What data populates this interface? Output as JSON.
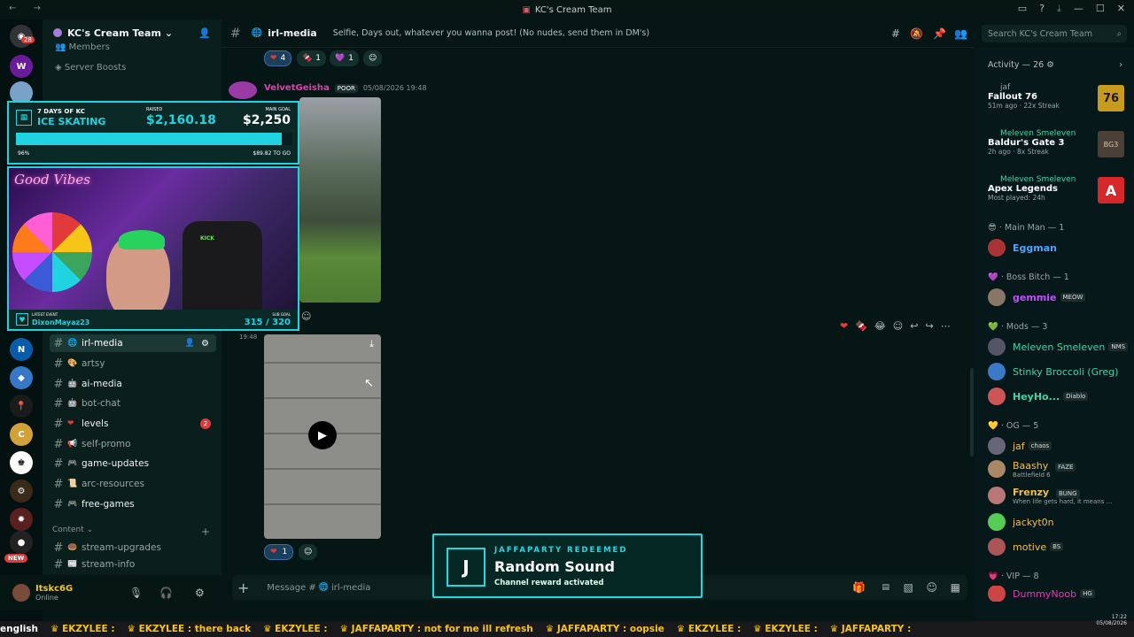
{
  "window": {
    "title": "KC's Cream Team"
  },
  "server": {
    "name": "KC's Cream Team",
    "dropdown": "⌄"
  },
  "nav_items": [
    "Members",
    "Server Boosts"
  ],
  "channels": [
    {
      "name": "irl-media",
      "emoji": "🌐",
      "bold": true,
      "active": true
    },
    {
      "name": "artsy",
      "emoji": "🎨",
      "bold": false
    },
    {
      "name": "ai-media",
      "emoji": "🤖",
      "bold": true
    },
    {
      "name": "bot-chat",
      "emoji": "🤖",
      "bold": false
    },
    {
      "name": "levels",
      "emoji": "❤",
      "bold": true,
      "badge": "2"
    },
    {
      "name": "self-promo",
      "emoji": "📢",
      "bold": false
    },
    {
      "name": "game-updates",
      "emoji": "🎮",
      "bold": true
    },
    {
      "name": "arc-resources",
      "emoji": "📜",
      "bold": false
    },
    {
      "name": "free-games",
      "emoji": "🎮",
      "bold": true
    }
  ],
  "category": {
    "label": "Content"
  },
  "more_channels": [
    {
      "name": "stream-upgrades",
      "emoji": "🍩"
    },
    {
      "name": "stream-info",
      "emoji": "📰"
    }
  ],
  "user": {
    "name": "Itskc6G",
    "status": "Online"
  },
  "chat_header": {
    "channel": "irl-media",
    "topic": "Selfie, Days out, whatever you wanna post! (No nudes, send them in DM's)"
  },
  "search": {
    "placeholder": "Search KC's Cream Team"
  },
  "messages": {
    "top_reactions": [
      {
        "emoji": "❤",
        "count": "4",
        "on": true
      },
      {
        "emoji": "🍫",
        "count": "1"
      },
      {
        "emoji": "💜",
        "count": "1"
      }
    ],
    "author": "VelvetGeisha",
    "author_tag": "POOR",
    "timestamp": "05/08/2026 19:48",
    "second_time": "19:48",
    "bottom_reaction": {
      "emoji": "❤",
      "count": "1"
    }
  },
  "composer": {
    "placeholder": "Message #",
    "channel": "irl-media"
  },
  "activity": {
    "header": "Activity — 26",
    "items": [
      {
        "user": "jaf",
        "game": "Fallout 76",
        "meta": "51m ago",
        "streak": "22x Streak",
        "icon": "76",
        "color": "#c89a1e"
      },
      {
        "user": "Meleven Smeleven",
        "game": "Baldur's Gate 3",
        "meta": "2h ago",
        "streak": "8x Streak",
        "icon": "BG3",
        "color": "#4a4038"
      },
      {
        "user": "Meleven Smeleven",
        "game": "Apex Legends",
        "meta": "Most played: 24h",
        "streak": "",
        "icon": "A",
        "color": "#d6272b"
      }
    ]
  },
  "member_sections": [
    {
      "label": "Main Man — 1"
    },
    {
      "label": "Boss Bitch — 1"
    },
    {
      "label": "Mods — 3"
    },
    {
      "label": "OG — 5"
    },
    {
      "label": "VIP — 8"
    }
  ],
  "members": [
    {
      "name": "Eggman",
      "color": "#4fa3ff",
      "tag": "",
      "sub": ""
    },
    {
      "name": "gemmie",
      "color": "#c34dff",
      "tag": "MEOW",
      "sub": ""
    },
    {
      "name": "Meleven Smeleven",
      "color": "#3dd6a3",
      "tag": "NMS",
      "sub": ""
    },
    {
      "name": "Stinky Broccoli (Greg)",
      "color": "#3dd6a3",
      "tag": "",
      "sub": ""
    },
    {
      "name": "HeyHo...",
      "color": "#3dd6a3",
      "tag": "Diablo",
      "sub": ""
    },
    {
      "name": "jaf",
      "color": "#f0c04a",
      "tag": "chaos",
      "sub": ""
    },
    {
      "name": "Baashy",
      "color": "#f0c04a",
      "tag": "FAZE",
      "sub": "Battlefield 6"
    },
    {
      "name": "Frenzy",
      "color": "#f0c04a",
      "tag": "BUNG",
      "sub": "When life gets hard, it means ..."
    },
    {
      "name": "jackyt0n",
      "color": "#f0c04a",
      "tag": "",
      "sub": ""
    },
    {
      "name": "motive",
      "color": "#f0c04a",
      "tag": "BS",
      "sub": ""
    },
    {
      "name": "DummyNoob",
      "color": "#e03db3",
      "tag": "HG",
      "sub": ""
    }
  ],
  "overlay": {
    "goal_days": "7 DAYS OF KC",
    "goal_title": "ICE SKATING",
    "raised_label": "RAISED",
    "raised": "$2,160.18",
    "main_goal_label": "MAIN GOAL",
    "main_goal": "$2,250",
    "percent": "96%",
    "percent_value": 0.96,
    "to_go": "$89.82 TO GO",
    "latest_event_label": "LATEST EVENT",
    "latest_event": "DixonMayaz23",
    "sub_goal_label": "SUB GOAL",
    "sub_goal": "315 / 320",
    "neon": "Good Vibes",
    "chair": "KICK"
  },
  "toast": {
    "letter": "J",
    "title": "JAFFAPARTY REDEEMED",
    "reward": "Random Sound",
    "sub": "Channel reward activated"
  },
  "ticker": [
    "english",
    "EKZYLEE :",
    "EKZYLEE : there back",
    "EKZYLEE :",
    "JAFFAPARTY : not for me ill refresh",
    "JAFFAPARTY : oopsie",
    "EKZYLEE :",
    "EKZYLEE :",
    "JAFFAPARTY :"
  ],
  "guild_badges": {
    "top": "28",
    "new": "NEW"
  },
  "clock": {
    "time": "17:22",
    "date": "05/08/2026"
  },
  "colors": {
    "accent": "#22d8e4",
    "bg": "#061614"
  }
}
